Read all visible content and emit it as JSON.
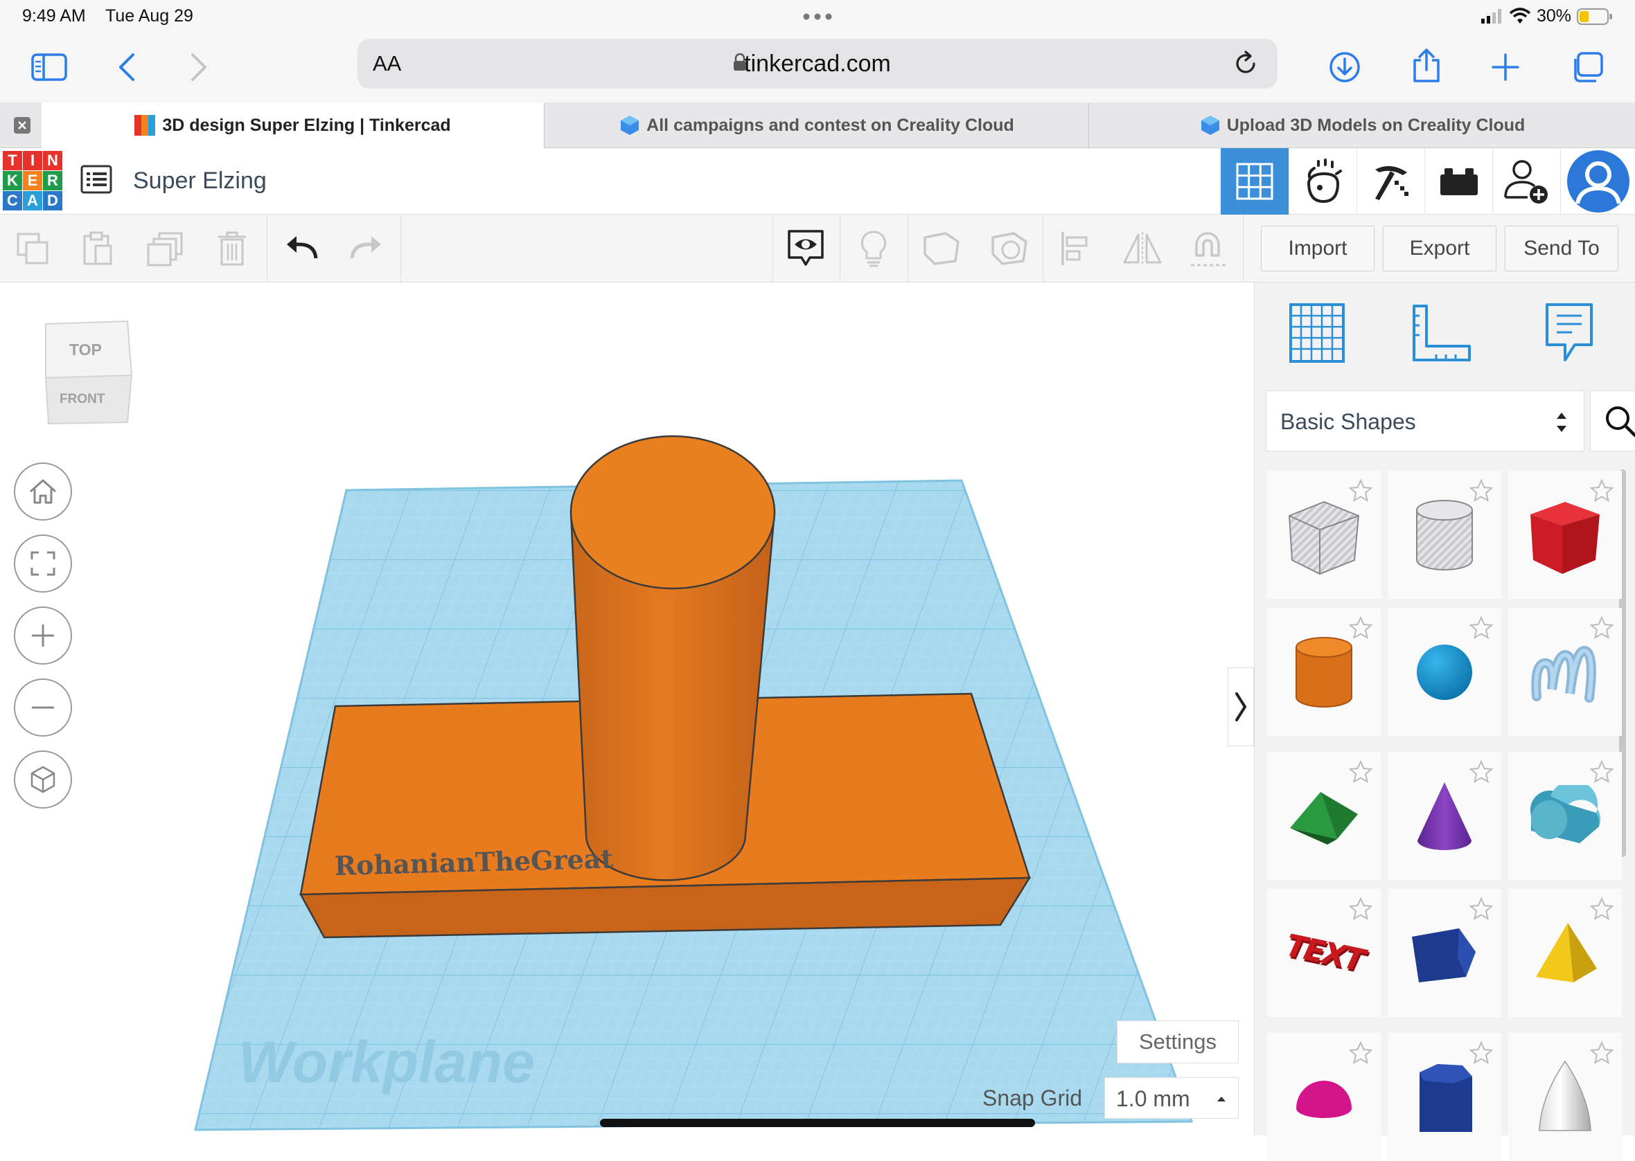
{
  "status_bar": {
    "time": "9:49 AM",
    "date": "Tue Aug 29",
    "battery": "30%",
    "battery_level": 0.3,
    "icons": [
      "more-dots-icon",
      "signal-icon",
      "wifi-icon",
      "battery-icon"
    ]
  },
  "safari": {
    "text_size_label": "AA",
    "url": "tinkercad.com",
    "icons": [
      "sidebar-icon",
      "back-icon",
      "forward-icon",
      "lock-icon",
      "reload-icon",
      "download-icon",
      "share-icon",
      "plus-icon",
      "tabs-icon"
    ]
  },
  "tabs": [
    {
      "label": "3D design Super Elzing | Tinkercad",
      "active": true,
      "icon": "tinkercad-favicon"
    },
    {
      "label": "All campaigns and contest on Creality Cloud",
      "active": false,
      "icon": "creality-favicon"
    },
    {
      "label": "Upload 3D Models on Creality Cloud",
      "active": false,
      "icon": "creality-favicon"
    }
  ],
  "tinkercad": {
    "logo_letters": [
      "T",
      "I",
      "N",
      "K",
      "E",
      "R",
      "C",
      "A",
      "D"
    ],
    "design_title": "Super Elzing",
    "nav_icons": [
      "grid-3d-icon",
      "codeblocks-icon",
      "minecraft-pickaxe-icon",
      "lego-bricks-icon",
      "invite-user-icon",
      "avatar-icon"
    ]
  },
  "toolbar": {
    "import_label": "Import",
    "export_label": "Export",
    "sendto_label": "Send To",
    "icons": [
      "copy-icon",
      "paste-icon",
      "duplicate-icon",
      "delete-icon",
      "undo-icon",
      "redo-icon",
      "notes-visibility-icon",
      "light-icon",
      "shape-solid-icon",
      "shape-hole-icon",
      "align-icon",
      "mirror-icon",
      "group-icon"
    ]
  },
  "viewport": {
    "view_cube_top": "TOP",
    "view_cube_front": "FRONT",
    "workplane_label": "Workplane",
    "engraved_text": "RohanianTheGreat",
    "settings_label": "Settings",
    "snap_grid_label": "Snap Grid",
    "snap_grid_value": "1.0 mm",
    "colors": {
      "orange": "#e87b1e",
      "workplane": "#a9d9ef",
      "grid_line": "#7fc3e0"
    },
    "view_controls": [
      "home-icon",
      "fit-view-icon",
      "zoom-in-icon",
      "zoom-out-icon",
      "perspective-icon"
    ]
  },
  "panel": {
    "tab_icons": [
      "workplane-grid-icon",
      "ruler-icon",
      "notes-icon"
    ],
    "category": "Basic Shapes",
    "shapes": [
      {
        "name": "box-hole",
        "icon": "box-hole-icon"
      },
      {
        "name": "cylinder-hole",
        "icon": "cylinder-hole-icon"
      },
      {
        "name": "box",
        "icon": "box-icon"
      },
      {
        "name": "cylinder",
        "icon": "cylinder-icon"
      },
      {
        "name": "sphere",
        "icon": "sphere-icon"
      },
      {
        "name": "scribble",
        "icon": "scribble-icon"
      },
      {
        "name": "roof",
        "icon": "roof-icon"
      },
      {
        "name": "cone",
        "icon": "cone-icon"
      },
      {
        "name": "round-roof",
        "icon": "round-roof-icon"
      },
      {
        "name": "text",
        "icon": "text-shape-icon"
      },
      {
        "name": "polygon",
        "icon": "polygon-icon"
      },
      {
        "name": "pyramid",
        "icon": "pyramid-icon"
      },
      {
        "name": "half-sphere",
        "icon": "half-sphere-icon"
      },
      {
        "name": "hexagonal-prism",
        "icon": "hexagonal-prism-icon"
      },
      {
        "name": "paraboloid",
        "icon": "paraboloid-icon"
      }
    ],
    "text_shape_label": "TEXT"
  }
}
